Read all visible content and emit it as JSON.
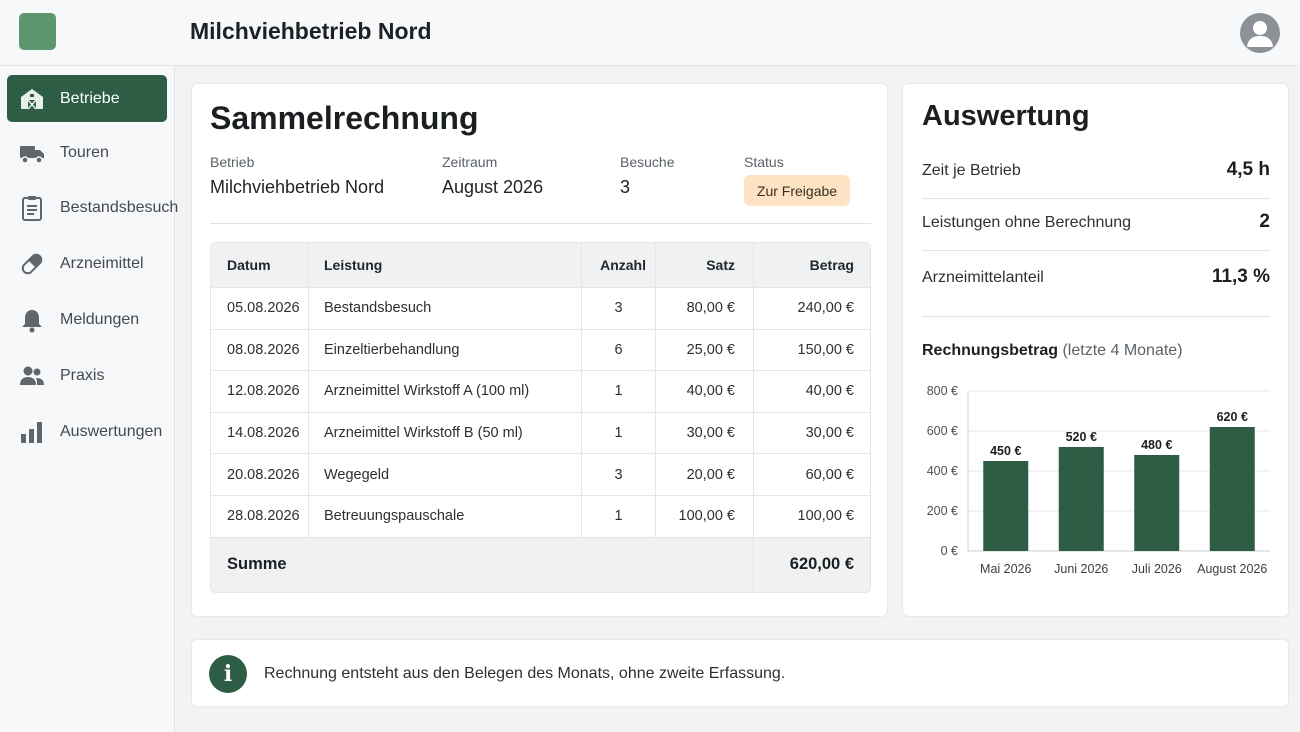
{
  "header": {
    "title": "Milchviehbetrieb Nord"
  },
  "sidebar": {
    "items": [
      {
        "label": "Betriebe",
        "icon": "barn-icon",
        "active": true
      },
      {
        "label": "Touren",
        "icon": "truck-icon",
        "active": false
      },
      {
        "label": "Bestandsbesuch",
        "icon": "clipboard-icon",
        "active": false
      },
      {
        "label": "Arzneimittel",
        "icon": "pill-icon",
        "active": false
      },
      {
        "label": "Meldungen",
        "icon": "bell-icon",
        "active": false
      },
      {
        "label": "Praxis",
        "icon": "users-icon",
        "active": false
      },
      {
        "label": "Auswertungen",
        "icon": "bar-chart-icon",
        "active": false
      }
    ]
  },
  "invoice": {
    "title": "Sammelrechnung",
    "meta": {
      "betrieb_label": "Betrieb",
      "betrieb_value": "Milchviehbetrieb Nord",
      "zeitraum_label": "Zeitraum",
      "zeitraum_value": "August 2026",
      "besuche_label": "Besuche",
      "besuche_value": "3",
      "status_label": "Status",
      "status_value": "Zur Freigabe"
    },
    "table": {
      "headers": [
        "Datum",
        "Leistung",
        "Anzahl",
        "Satz",
        "Betrag"
      ],
      "rows": [
        [
          "05.08.2026",
          "Bestandsbesuch",
          "3",
          "80,00 €",
          "240,00 €"
        ],
        [
          "08.08.2026",
          "Einzeltierbehandlung",
          "6",
          "25,00 €",
          "150,00 €"
        ],
        [
          "12.08.2026",
          "Arzneimittel Wirkstoff A (100 ml)",
          "1",
          "40,00 €",
          "40,00 €"
        ],
        [
          "14.08.2026",
          "Arzneimittel Wirkstoff B (50 ml)",
          "1",
          "30,00 €",
          "30,00 €"
        ],
        [
          "20.08.2026",
          "Wegegeld",
          "3",
          "20,00 €",
          "60,00 €"
        ],
        [
          "28.08.2026",
          "Betreuungspauschale",
          "1",
          "100,00 €",
          "100,00 €"
        ]
      ],
      "sum_label": "Summe",
      "sum_value": "620,00 €"
    }
  },
  "evaluation": {
    "title": "Auswertung",
    "kpis": [
      {
        "label": "Zeit je Betrieb",
        "value": "4,5 h"
      },
      {
        "label": "Leistungen ohne Berechnung",
        "value": "2"
      },
      {
        "label": "Arzneimittelanteil",
        "value": "11,3 %"
      }
    ],
    "chart_title": "Rechnungsbetrag",
    "chart_subtitle": "(letzte 4 Monate)"
  },
  "chart_data": {
    "type": "bar",
    "categories": [
      "Mai 2026",
      "Juni 2026",
      "Juli 2026",
      "August 2026"
    ],
    "values": [
      450,
      520,
      480,
      620
    ],
    "data_labels": [
      "450 €",
      "520 €",
      "480 €",
      "620 €"
    ],
    "y_ticks": [
      0,
      200,
      400,
      600,
      800
    ],
    "y_tick_labels": [
      "0 €",
      "200 €",
      "400 €",
      "600 €",
      "800 €"
    ],
    "ylim": [
      0,
      800
    ],
    "grid": true,
    "bar_color": "#2d5e45"
  },
  "info": {
    "text": "Rechnung entsteht aus den Belegen des Monats, ohne zweite Erfassung."
  },
  "colors": {
    "accent": "#2d5e45",
    "status_badge_bg": "#fde3c3"
  }
}
